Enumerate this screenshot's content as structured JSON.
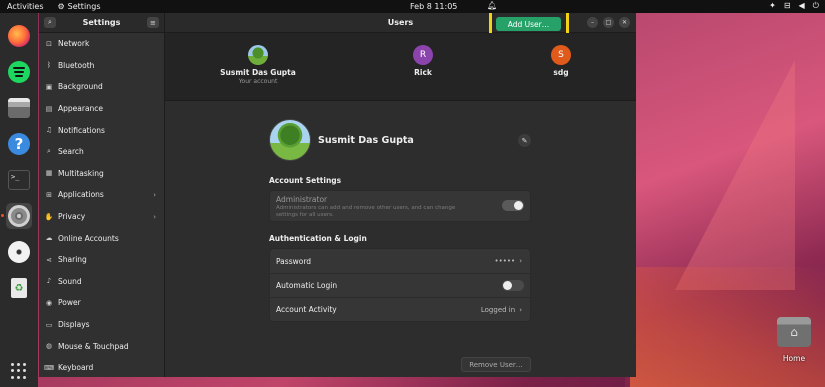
{
  "topbar": {
    "activities": "Activities",
    "app_name": "Settings",
    "clock": "Feb 8  11:05",
    "tray_icons": [
      "accessibility-icon",
      "network-icon",
      "volume-icon",
      "power-icon"
    ]
  },
  "dock": {
    "items": [
      "Firefox",
      "Spotify",
      "Files",
      "Help",
      "Terminal",
      "Settings",
      "Disc",
      "Trash"
    ],
    "active": "Settings"
  },
  "sidebar": {
    "title": "Settings",
    "items": [
      {
        "label": "Network",
        "icon": "network-icon"
      },
      {
        "label": "Bluetooth",
        "icon": "bluetooth-icon"
      },
      {
        "label": "Background",
        "icon": "background-icon"
      },
      {
        "label": "Appearance",
        "icon": "appearance-icon"
      },
      {
        "label": "Notifications",
        "icon": "bell-icon"
      },
      {
        "label": "Search",
        "icon": "search-icon"
      },
      {
        "label": "Multitasking",
        "icon": "multitasking-icon"
      },
      {
        "label": "Applications",
        "icon": "applications-icon",
        "chevron": "›"
      },
      {
        "label": "Privacy",
        "icon": "privacy-icon",
        "chevron": "›"
      },
      {
        "label": "Online Accounts",
        "icon": "cloud-icon"
      },
      {
        "label": "Sharing",
        "icon": "sharing-icon"
      },
      {
        "label": "Sound",
        "icon": "music-icon"
      },
      {
        "label": "Power",
        "icon": "power-icon"
      },
      {
        "label": "Displays",
        "icon": "display-icon"
      },
      {
        "label": "Mouse & Touchpad",
        "icon": "mouse-icon"
      },
      {
        "label": "Keyboard",
        "icon": "keyboard-icon"
      }
    ]
  },
  "header": {
    "title": "Users",
    "add_user": "Add User…"
  },
  "users": [
    {
      "name": "Susmit Das Gupta",
      "subtitle": "Your account",
      "initial": "",
      "color": ""
    },
    {
      "name": "Rick",
      "subtitle": "",
      "initial": "R",
      "color": "#8c44ad"
    },
    {
      "name": "sdg",
      "subtitle": "",
      "initial": "S",
      "color": "#e05a1b"
    }
  ],
  "profile": {
    "name": "Susmit Das Gupta"
  },
  "account_settings": {
    "title": "Account Settings",
    "admin_label": "Administrator",
    "admin_desc": "Administrators can add and remove other users, and can change settings for all users.",
    "admin_toggle": true
  },
  "auth": {
    "title": "Authentication & Login",
    "password_label": "Password",
    "password_value": "•••••",
    "auto_login_label": "Automatic Login",
    "auto_login": false,
    "activity_label": "Account Activity",
    "activity_value": "Logged in"
  },
  "remove_user": "Remove User…",
  "desktop": {
    "home_label": "Home"
  },
  "colors": {
    "accent_green": "#26a269",
    "highlight": "#f5d21a",
    "ubuntu_orange": "#e95420"
  }
}
